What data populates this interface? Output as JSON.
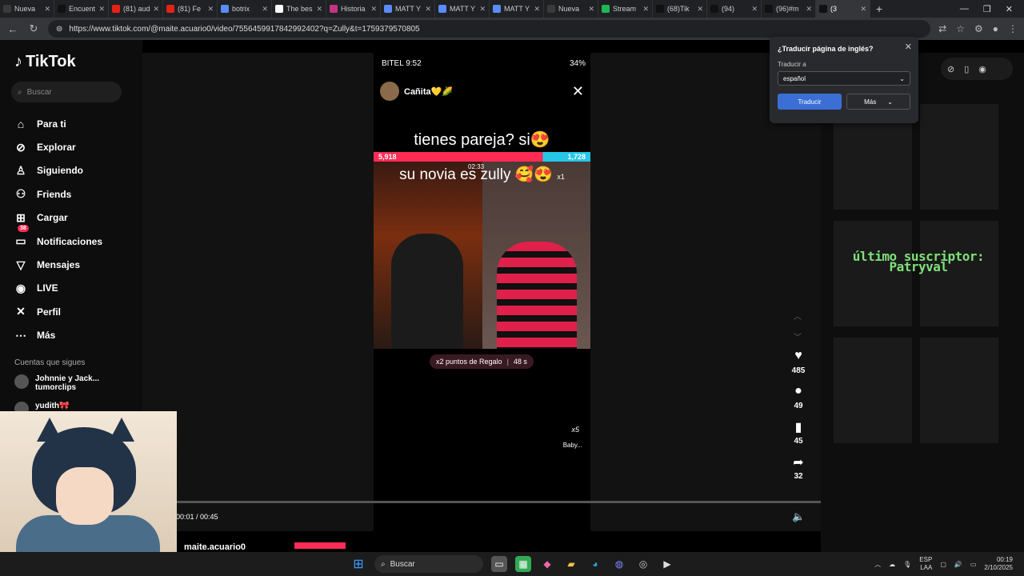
{
  "browser": {
    "tabs": [
      {
        "label": "Nueva",
        "color": "#3a3a3a"
      },
      {
        "label": "Encuent",
        "color": "#111111"
      },
      {
        "label": "(81) aud",
        "color": "#e62117"
      },
      {
        "label": "(81) Fe",
        "color": "#e62117"
      },
      {
        "label": "botrix",
        "color": "#5b8cff"
      },
      {
        "label": "The bes",
        "color": "#ffffff"
      },
      {
        "label": "Historia",
        "color": "#c13584"
      },
      {
        "label": "MATT Y",
        "color": "#5b8cff"
      },
      {
        "label": "MATT Y",
        "color": "#5b8cff"
      },
      {
        "label": "MATT Y",
        "color": "#5b8cff"
      },
      {
        "label": "Nueva",
        "color": "#3a3a3a"
      },
      {
        "label": "Stream",
        "color": "#1db954"
      },
      {
        "label": "(68)Tik",
        "color": "#111111"
      },
      {
        "label": "(94)",
        "color": "#111111"
      },
      {
        "label": "(96)#m",
        "color": "#111111"
      },
      {
        "label": "(3",
        "color": "#111111"
      }
    ],
    "url": "https://www.tiktok.com/@maite.acuario0/video/7556459917842992402?q=Zully&t=1759379570805"
  },
  "sidebar": {
    "logo": "TikTok",
    "search_placeholder": "Buscar",
    "items": [
      {
        "label": "Para ti",
        "icon": "⌂"
      },
      {
        "label": "Explorar",
        "icon": "⊘"
      },
      {
        "label": "Siguiendo",
        "icon": "♙"
      },
      {
        "label": "Friends",
        "icon": "⚇"
      },
      {
        "label": "Cargar",
        "icon": "⊞"
      },
      {
        "label": "Notificaciones",
        "icon": "▭",
        "badge": "38"
      },
      {
        "label": "Mensajes",
        "icon": "▽"
      },
      {
        "label": "LIVE",
        "icon": "◉"
      },
      {
        "label": "Perfil",
        "icon": "✕"
      },
      {
        "label": "Más",
        "icon": "⋯"
      }
    ],
    "following_title": "Cuentas que sigues",
    "following": [
      {
        "name": "Johnnie y Jack...",
        "sub": "tumorclips"
      },
      {
        "name": "yudith🎀",
        "sub": ""
      }
    ]
  },
  "video": {
    "status_left": "BITEL 9:52",
    "status_right": "34%",
    "host_name": "Cañita💛🌽",
    "caption_top": "tienes pareja? si😍",
    "score_left": "5,918",
    "score_right": "1,728",
    "timer": "02:33",
    "caption_bottom": "su novia es zully 🥰😍",
    "multiplier": "x1",
    "gift_text": "x2 puntos de Regalo",
    "gift_time": "48 s",
    "baby_label": "Baby...",
    "x5": "x5",
    "time": "00:01 / 00:45",
    "username": "maite.acuario0"
  },
  "actions": {
    "likes": "485",
    "comments": "49",
    "saves": "45",
    "shares": "32"
  },
  "overlay": {
    "subscriber_line1": "último suscriptor:",
    "subscriber_line2": "Patryval"
  },
  "translate": {
    "title": "¿Traducir página de inglés?",
    "label": "Traducir a",
    "language": "español",
    "translate_btn": "Traducir",
    "more_btn": "Más"
  },
  "taskbar": {
    "search": "Buscar",
    "lang1": "ESP",
    "lang2": "LAA",
    "time": "00:19",
    "date": "2/10/2025"
  }
}
